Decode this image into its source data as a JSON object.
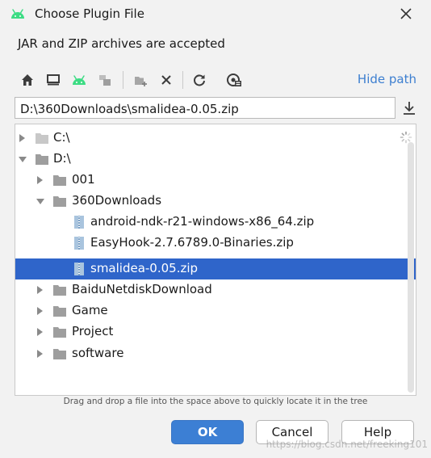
{
  "dialog": {
    "title": "Choose Plugin File",
    "subtitle": "JAR and ZIP archives are accepted"
  },
  "toolbar": {
    "hide_path_label": "Hide path",
    "icons": [
      "home-icon",
      "desktop-icon",
      "android-icon",
      "module-icon",
      "new-folder-icon",
      "delete-icon",
      "refresh-icon",
      "show-hidden-icon"
    ]
  },
  "path": {
    "value": "D:\\360Downloads\\smalidea-0.05.zip"
  },
  "tree": {
    "rows": [
      {
        "label": "C:\\",
        "type": "drive",
        "expanded": false
      },
      {
        "label": "D:\\",
        "type": "drive",
        "expanded": true
      },
      {
        "label": "001",
        "type": "folder",
        "expanded": false
      },
      {
        "label": "360Downloads",
        "type": "folder",
        "expanded": true
      },
      {
        "label": "android-ndk-r21-windows-x86_64.zip",
        "type": "zip"
      },
      {
        "label": "EasyHook-2.7.6789.0-Binaries.zip",
        "type": "zip"
      },
      {
        "label": "smalidea-0.05.zip",
        "type": "zip",
        "selected": true
      },
      {
        "label": "BaiduNetdiskDownload",
        "type": "folder",
        "expanded": false
      },
      {
        "label": "Game",
        "type": "folder",
        "expanded": false
      },
      {
        "label": "Project",
        "type": "folder",
        "expanded": false
      },
      {
        "label": "software",
        "type": "folder",
        "expanded": false
      }
    ]
  },
  "hint": "Drag and drop a file into the space above to quickly locate it in the tree",
  "buttons": {
    "ok": "OK",
    "cancel": "Cancel",
    "help": "Help"
  },
  "watermark": "https://blog.csdn.net/freeking101",
  "colors": {
    "selection": "#2f65ca",
    "accent": "#3c7fd4",
    "link": "#3d7fd0",
    "android_green": "#3ddc84"
  }
}
